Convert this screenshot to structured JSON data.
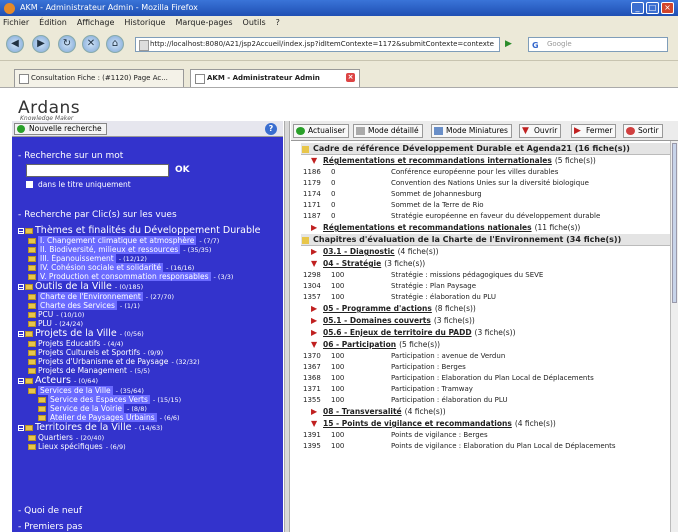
{
  "window": {
    "title": "AKM - Administrateur Admin - Mozilla Firefox"
  },
  "menu": [
    "Fichier",
    "Édition",
    "Affichage",
    "Historique",
    "Marque-pages",
    "Outils",
    "?"
  ],
  "url": "http://localhost:8080/A21/jsp2Accueil/index.jsp?idItemContexte=1172&submitContexte=contexte",
  "search_placeholder": "Google",
  "tabs": [
    {
      "label": "Consultation Fiche : (#1120) Page Ac...",
      "active": false
    },
    {
      "label": "AKM - Administrateur Admin",
      "active": true
    }
  ],
  "logo": {
    "name": "Ardans",
    "tagline": "Knowledge Maker"
  },
  "left": {
    "new_search": "Nouvelle recherche",
    "help": "?",
    "word_section": "- Recherche sur un mot",
    "ok": "OK",
    "title_only": "dans le titre uniquement",
    "views_section": "- Recherche par Clic(s) sur les vues",
    "tree": [
      {
        "level": 1,
        "label": "Thèmes et finalités du Développement Durable",
        "count": ""
      },
      {
        "level": 2,
        "label": "I. Changement climatique et atmosphère",
        "count": "- (7/7)",
        "hl": true
      },
      {
        "level": 2,
        "label": "II. Biodiversité, milieux et ressources",
        "count": "- (35/35)",
        "hl": true
      },
      {
        "level": 2,
        "label": "III. Épanouissement",
        "count": "- (12/12)",
        "hl": true
      },
      {
        "level": 2,
        "label": "IV. Cohésion sociale et solidarité",
        "count": "- (16/16)",
        "hl": true
      },
      {
        "level": 2,
        "label": "V. Production et consommation responsables",
        "count": "- (3/3)",
        "hl": true
      },
      {
        "level": 1,
        "label": "Outils de la Ville",
        "count": "- (0/185)"
      },
      {
        "level": 2,
        "label": "Charte de l'Environnement",
        "count": "- (27/70)",
        "hl": true
      },
      {
        "level": 2,
        "label": "Charte des Services",
        "count": "- (1/1)",
        "hl": true
      },
      {
        "level": 2,
        "label": "PCU",
        "count": "- (10/10)"
      },
      {
        "level": 2,
        "label": "PLU",
        "count": "- (24/24)"
      },
      {
        "level": 1,
        "label": "Projets de la Ville",
        "count": "- (0/56)"
      },
      {
        "level": 2,
        "label": "Projets Educatifs",
        "count": "- (4/4)"
      },
      {
        "level": 2,
        "label": "Projets Culturels et Sportifs",
        "count": "- (9/9)"
      },
      {
        "level": 2,
        "label": "Projets d'Urbanisme et de Paysage",
        "count": "- (32/32)"
      },
      {
        "level": 2,
        "label": "Projets de Management",
        "count": "- (5/5)"
      },
      {
        "level": 1,
        "label": "Acteurs",
        "count": "- (0/64)"
      },
      {
        "level": 2,
        "label": "Services de la Ville",
        "count": "- (35/64)",
        "hl": true
      },
      {
        "level": 3,
        "label": "Service des Espaces Verts",
        "count": "- (15/15)",
        "hl": true
      },
      {
        "level": 3,
        "label": "Service de la Voirie",
        "count": "- (8/8)",
        "hl": true
      },
      {
        "level": 3,
        "label": "Atelier de Paysages Urbains",
        "count": "- (6/6)",
        "hl": true
      },
      {
        "level": 1,
        "label": "Territoires de la Ville",
        "count": "- (14/63)"
      },
      {
        "level": 2,
        "label": "Quartiers",
        "count": "- (20/40)"
      },
      {
        "level": 2,
        "label": "Lieux spécifiques",
        "count": "- (6/9)"
      }
    ],
    "bottom": [
      "- Quoi de neuf",
      "- Premiers pas"
    ]
  },
  "toolbar": [
    {
      "label": "Actualiser",
      "icon": "refresh-icon",
      "color": "#2aa02a"
    },
    {
      "label": "Mode détaillé",
      "icon": "detail-icon",
      "color": "#888888"
    },
    {
      "label": "Mode Miniatures",
      "icon": "thumbnails-icon",
      "color": "#6a8fc8"
    },
    {
      "label": "Ouvrir",
      "icon": "open-icon",
      "color": "#c02020"
    },
    {
      "label": "Fermer",
      "icon": "close-arrow-icon",
      "color": "#c02020"
    },
    {
      "label": "Sortir",
      "icon": "exit-icon",
      "color": "#d04040"
    }
  ],
  "groups": [
    {
      "title": "Cadre de référence Développement Durable et Agenda21 (16 fiche(s))",
      "items": [
        {
          "type": "cat",
          "name": "Réglementations et recommandations internationales",
          "count": "(5 fiche(s))",
          "open": true
        },
        {
          "type": "row",
          "id": "1186",
          "v": "0",
          "text": "Conférence européenne pour les villes durables"
        },
        {
          "type": "row",
          "id": "1179",
          "v": "0",
          "text": "Convention des Nations Unies sur la diversité biologique"
        },
        {
          "type": "row",
          "id": "1174",
          "v": "0",
          "text": "Sommet de Johannesburg"
        },
        {
          "type": "row",
          "id": "1171",
          "v": "0",
          "text": "Sommet de la Terre de Rio"
        },
        {
          "type": "row",
          "id": "1187",
          "v": "0",
          "text": "Stratégie européenne en faveur du développement durable"
        },
        {
          "type": "cat",
          "name": "Réglementations et recommandations nationales",
          "count": "(11 fiche(s))",
          "open": false
        }
      ]
    },
    {
      "title": "Chapitres d'évaluation de la Charte de l'Environnement (34 fiche(s))",
      "items": [
        {
          "type": "cat",
          "name": "03.1 - Diagnostic",
          "count": "(4 fiche(s))",
          "open": false
        },
        {
          "type": "cat",
          "name": "04 - Stratégie",
          "count": "(3 fiche(s))",
          "open": true
        },
        {
          "type": "row",
          "id": "1298",
          "v": "100",
          "text": "Stratégie : missions pédagogiques du SEVE"
        },
        {
          "type": "row",
          "id": "1304",
          "v": "100",
          "text": "Stratégie : Plan Paysage"
        },
        {
          "type": "row",
          "id": "1357",
          "v": "100",
          "text": "Stratégie : élaboration du PLU"
        },
        {
          "type": "cat",
          "name": "05 - Programme d'actions",
          "count": "(8 fiche(s))",
          "open": false
        },
        {
          "type": "cat",
          "name": "05.1 - Domaines couverts",
          "count": "(3 fiche(s))",
          "open": false
        },
        {
          "type": "cat",
          "name": "05.6 - Enjeux de territoire du PADD",
          "count": "(3 fiche(s))",
          "open": false
        },
        {
          "type": "cat",
          "name": "06 - Participation",
          "count": "(5 fiche(s))",
          "open": true
        },
        {
          "type": "row",
          "id": "1370",
          "v": "100",
          "text": "Participation : avenue de Verdun"
        },
        {
          "type": "row",
          "id": "1367",
          "v": "100",
          "text": "Participation : Berges"
        },
        {
          "type": "row",
          "id": "1368",
          "v": "100",
          "text": "Participation : Elaboration du Plan Local de Déplacements"
        },
        {
          "type": "row",
          "id": "1371",
          "v": "100",
          "text": "Participation : Tramway"
        },
        {
          "type": "row",
          "id": "1355",
          "v": "100",
          "text": "Participation : élaboration du PLU"
        },
        {
          "type": "cat",
          "name": "08 - Transversalité",
          "count": "(4 fiche(s))",
          "open": false
        },
        {
          "type": "cat",
          "name": "15 - Points de vigilance et recommandations",
          "count": "(4 fiche(s))",
          "open": true
        },
        {
          "type": "row",
          "id": "1391",
          "v": "100",
          "text": "Points de vigilance : Berges"
        },
        {
          "type": "row",
          "id": "1395",
          "v": "100",
          "text": "Points de vigilance : Elaboration du Plan Local de Déplacements"
        }
      ]
    }
  ]
}
